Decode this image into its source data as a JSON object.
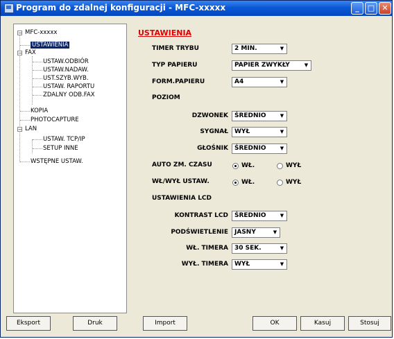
{
  "window": {
    "title": "Program do zdalnej konfiguracji - MFC-xxxxx"
  },
  "tree": {
    "root": "MFC-xxxxx",
    "items": [
      "USTAWIENIA",
      "FAX",
      "USTAW.ODBIÓR",
      "USTAW.NADAW.",
      "UST.SZYB.WYB.",
      "USTAW. RAPORTU",
      "ZDALNY ODB.FAX",
      "KOPIA",
      "PHOTOCAPTURE",
      "LAN",
      "USTAW. TCP/IP",
      "SETUP INNE",
      "WSTĘPNE USTAW."
    ]
  },
  "section": {
    "title": "USTAWIENIA"
  },
  "settings": {
    "timer_trybu": {
      "label": "TIMER TRYBU",
      "value": "2 MIN."
    },
    "typ_papieru": {
      "label": "TYP PAPIERU",
      "value": "PAPIER ZWYKŁY"
    },
    "form_papieru": {
      "label": "FORM.PAPIERU",
      "value": "A4"
    },
    "poziom": {
      "label": "POZIOM"
    },
    "dzwonek": {
      "label": "DZWONEK",
      "value": "ŚREDNIO"
    },
    "sygnal": {
      "label": "SYGNAŁ",
      "value": "WYŁ"
    },
    "glosnik": {
      "label": "GŁOŚNIK",
      "value": "ŚREDNIO"
    },
    "auto_zm_czasu": {
      "label": "AUTO ZM. CZASU",
      "on": "WŁ.",
      "off": "WYŁ"
    },
    "wl_wyl_ustaw": {
      "label": "WŁ/WYŁ USTAW.",
      "on": "WŁ.",
      "off": "WYŁ"
    },
    "lcd_heading": {
      "label": "USTAWIENIA LCD"
    },
    "kontrast_lcd": {
      "label": "KONTRAST LCD",
      "value": "ŚREDNIO"
    },
    "podswietlenie": {
      "label": "PODŚWIETLENIE",
      "value": "JASNY"
    },
    "wl_timera": {
      "label": "WŁ. TIMERA",
      "value": "30 SEK."
    },
    "wyl_timera": {
      "label": "WYŁ. TIMERA",
      "value": "WYŁ"
    }
  },
  "buttons": {
    "eksport": "Eksport",
    "druk": "Druk",
    "import": "Import",
    "ok": "OK",
    "kasuj": "Kasuj",
    "stosuj": "Stosuj"
  },
  "colors": {
    "section_title": "#e00000",
    "titlebar": "#0a58d6",
    "tree_selection": "#0a246a"
  }
}
